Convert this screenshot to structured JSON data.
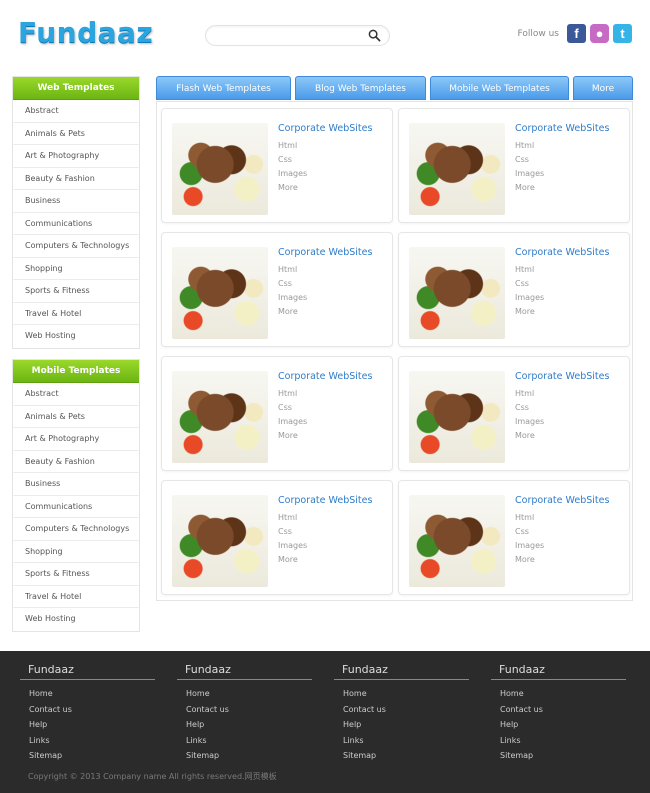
{
  "header": {
    "logo": "Fundaaz",
    "search": {
      "placeholder": ""
    },
    "follow_label": "Follow us",
    "social": [
      {
        "icon": "facebook-icon",
        "glyph": "f"
      },
      {
        "icon": "flickr-icon",
        "glyph": "●"
      },
      {
        "icon": "twitter-icon",
        "glyph": "t"
      }
    ]
  },
  "sidebar": {
    "web": {
      "title": "Web Templates",
      "items": [
        "Abstract",
        "Animals & Pets",
        "Art & Photography",
        "Beauty & Fashion",
        "Business",
        "Communications",
        "Computers & Technologys",
        "Shopping",
        "Sports & Fitness",
        "Travel & Hotel",
        "Web Hosting"
      ]
    },
    "mobile": {
      "title": "Mobile Templates",
      "items": [
        "Abstract",
        "Animals & Pets",
        "Art & Photography",
        "Beauty & Fashion",
        "Business",
        "Communications",
        "Computers & Technologys",
        "Shopping",
        "Sports & Fitness",
        "Travel & Hotel",
        "Web Hosting"
      ]
    }
  },
  "tabs": [
    "Flash Web Templates",
    "Blog Web Templates",
    "Mobile Web Templates",
    "More"
  ],
  "cards": [
    {
      "title": "Corporate WebSites",
      "links": [
        "Html",
        "Css",
        "Images",
        "More"
      ]
    },
    {
      "title": "Corporate WebSites",
      "links": [
        "Html",
        "Css",
        "Images",
        "More"
      ]
    },
    {
      "title": "Corporate WebSites",
      "links": [
        "Html",
        "Css",
        "Images",
        "More"
      ]
    },
    {
      "title": "Corporate WebSites",
      "links": [
        "Html",
        "Css",
        "Images",
        "More"
      ]
    },
    {
      "title": "Corporate WebSites",
      "links": [
        "Html",
        "Css",
        "Images",
        "More"
      ]
    },
    {
      "title": "Corporate WebSites",
      "links": [
        "Html",
        "Css",
        "Images",
        "More"
      ]
    },
    {
      "title": "Corporate WebSites",
      "links": [
        "Html",
        "Css",
        "Images",
        "More"
      ]
    },
    {
      "title": "Corporate WebSites",
      "links": [
        "Html",
        "Css",
        "Images",
        "More"
      ]
    }
  ],
  "footer": {
    "columns": [
      {
        "title": "Fundaaz",
        "links": [
          "Home",
          "Contact us",
          "Help",
          "Links",
          "Sitemap"
        ]
      },
      {
        "title": "Fundaaz",
        "links": [
          "Home",
          "Contact us",
          "Help",
          "Links",
          "Sitemap"
        ]
      },
      {
        "title": "Fundaaz",
        "links": [
          "Home",
          "Contact us",
          "Help",
          "Links",
          "Sitemap"
        ]
      },
      {
        "title": "Fundaaz",
        "links": [
          "Home",
          "Contact us",
          "Help",
          "Links",
          "Sitemap"
        ]
      }
    ],
    "copyright": "Copyright © 2013 Company name All rights reserved.网页模板"
  },
  "colors": {
    "accent_blue": "#4a9bea",
    "sidebar_green": "#6cb514",
    "title_blue": "#2f7bc9",
    "footer_bg": "#2b2b2b"
  }
}
